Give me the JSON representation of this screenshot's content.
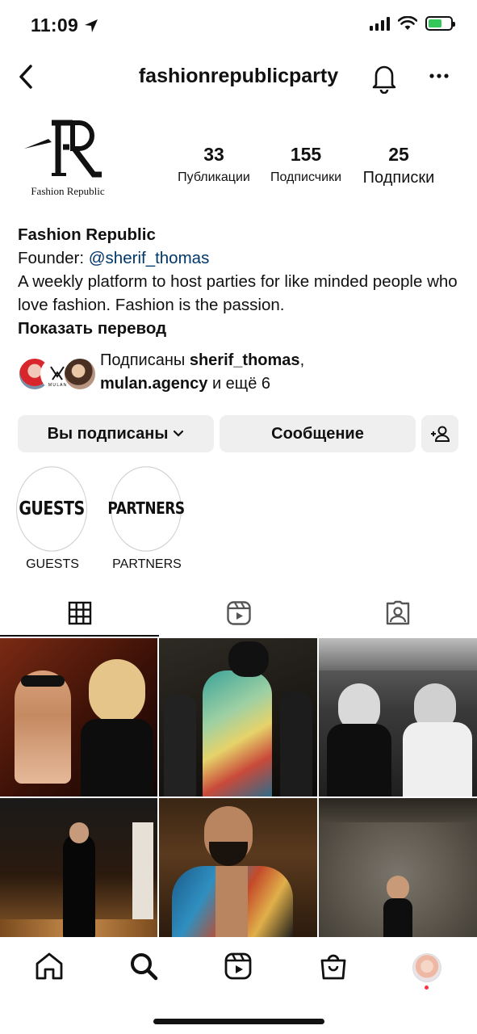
{
  "status_bar": {
    "time": "11:09"
  },
  "header": {
    "username": "fashionrepublicparty"
  },
  "profile": {
    "logo_text": "Fashion Republic",
    "stats": [
      {
        "value": "33",
        "label": "Публикации"
      },
      {
        "value": "155",
        "label": "Подписчики"
      },
      {
        "value": "25",
        "label": "Подписки"
      }
    ],
    "name": "Fashion Republic",
    "bio_prefix": "Founder: ",
    "bio_mention": "@sherif_thomas",
    "bio_text": "A weekly platform to host parties for like minded people who love fashion.  Fashion is the passion.",
    "translate": "Показать перевод"
  },
  "followed_by": {
    "prefix": "Подписаны ",
    "user1": "sherif_thomas",
    "separator": ",",
    "user2": "mulan.agency",
    "suffix": " и ещё 6"
  },
  "actions": {
    "following": "Вы подписаны",
    "message": "Сообщение"
  },
  "highlights": [
    {
      "cover": "GUESTS",
      "label": "GUESTS"
    },
    {
      "cover": "PARTNERS",
      "label": "PARTNERS"
    }
  ],
  "tabs": [
    "grid-icon",
    "reels-icon",
    "tagged-icon"
  ],
  "nav": [
    "home-icon",
    "search-icon",
    "reels-icon",
    "shop-icon",
    "profile-avatar"
  ],
  "colors": {
    "mention": "#00376b",
    "button_bg": "#efefef",
    "battery": "#34c759",
    "notify_dot": "#ff3040"
  }
}
